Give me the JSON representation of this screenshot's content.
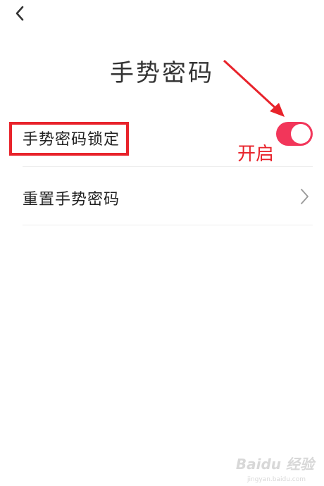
{
  "header": {
    "back_icon": "chevron-left-icon",
    "title": "手势密码"
  },
  "settings": {
    "lock": {
      "label": "手势密码锁定",
      "enabled": true,
      "accent_color": "#f2365a"
    },
    "reset": {
      "label": "重置手势密码",
      "icon": "chevron-right-icon"
    }
  },
  "annotations": {
    "callout_text": "开启",
    "color": "#e8232b"
  },
  "watermark": {
    "text": "Baidu 经验",
    "url_text": "jingyan.baidu.com"
  }
}
